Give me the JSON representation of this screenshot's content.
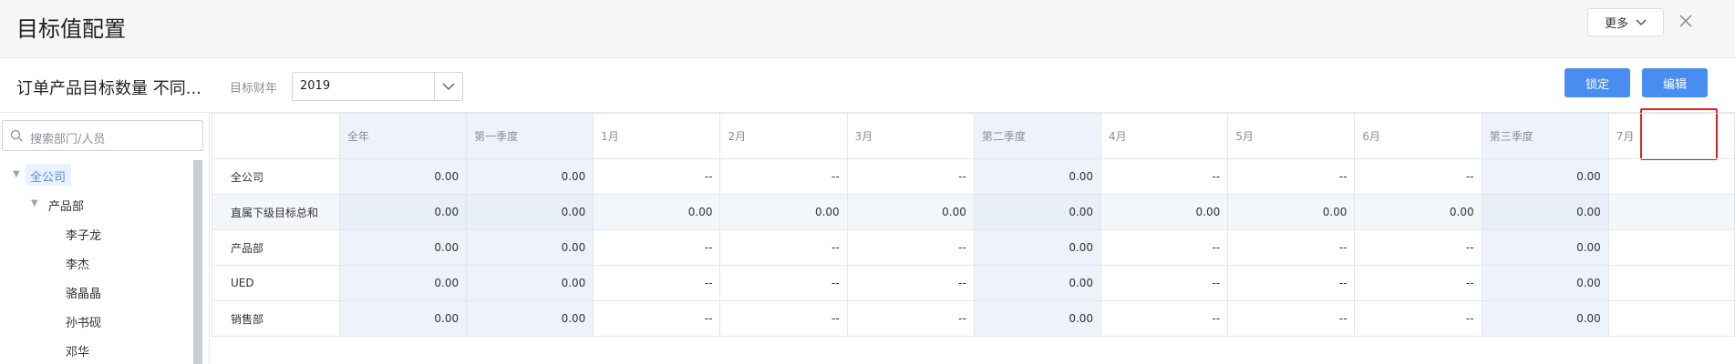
{
  "header": {
    "title": "目标值配置",
    "more_label": "更多"
  },
  "toolbar": {
    "subtitle": "订单产品目标数量 不同...",
    "year_label": "目标财年",
    "year_value": "2019",
    "lock_label": "锁定",
    "edit_label": "编辑"
  },
  "sidebar": {
    "search_placeholder": "搜索部门/人员",
    "tree": [
      {
        "label": "全公司",
        "level": 0,
        "expanded": true,
        "selected": true
      },
      {
        "label": "产品部",
        "level": 1,
        "expanded": true
      },
      {
        "label": "李子龙",
        "level": 2
      },
      {
        "label": "李杰",
        "level": 2
      },
      {
        "label": "骆晶晶",
        "level": 2
      },
      {
        "label": "孙书砚",
        "level": 2
      },
      {
        "label": "邓华",
        "level": 2
      }
    ]
  },
  "table": {
    "columns": [
      "",
      "全年",
      "第一季度",
      "1月",
      "2月",
      "3月",
      "第二季度",
      "4月",
      "5月",
      "6月",
      "第三季度",
      "7月"
    ],
    "rows": [
      {
        "name": "全公司",
        "cells": [
          "0.00",
          "0.00",
          "--",
          "--",
          "--",
          "0.00",
          "--",
          "--",
          "--",
          "0.00",
          ""
        ]
      },
      {
        "name": "直属下级目标总和",
        "cells": [
          "0.00",
          "0.00",
          "0.00",
          "0.00",
          "0.00",
          "0.00",
          "0.00",
          "0.00",
          "0.00",
          "0.00",
          ""
        ]
      },
      {
        "name": "产品部",
        "cells": [
          "0.00",
          "0.00",
          "--",
          "--",
          "--",
          "0.00",
          "--",
          "--",
          "--",
          "0.00",
          ""
        ]
      },
      {
        "name": "UED",
        "cells": [
          "0.00",
          "0.00",
          "--",
          "--",
          "--",
          "0.00",
          "--",
          "--",
          "--",
          "0.00",
          ""
        ]
      },
      {
        "name": "销售部",
        "cells": [
          "0.00",
          "0.00",
          "--",
          "--",
          "--",
          "0.00",
          "--",
          "--",
          "--",
          "0.00",
          ""
        ]
      }
    ]
  },
  "colors": {
    "primary": "#4a8df0",
    "highlight": "#e02020",
    "shade": "#eef3fb"
  }
}
